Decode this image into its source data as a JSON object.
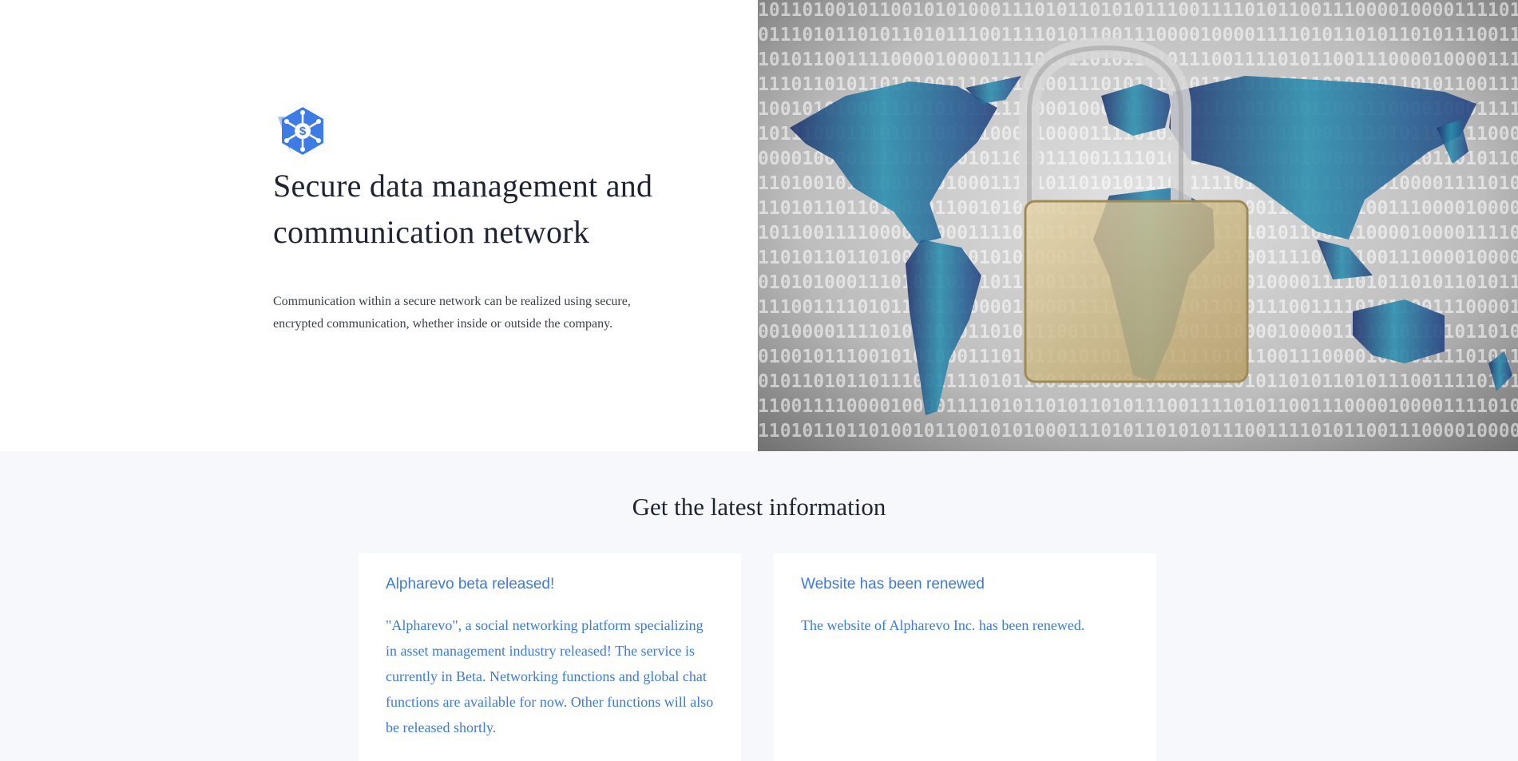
{
  "hero": {
    "title": "Secure data management and communication network",
    "description": "Communication within a secure network can be realized using secure, encrypted communication, whether inside or outside the company.",
    "logo_icon": "hexagon-dollar-network-icon",
    "image_alt": "padlock-world-map-binary-image",
    "binary_rows": [
      "1011010010110010101000111010110101011100111101011001110000100001111010",
      "0111010110101101011100111101011001110000100001111010110101101011100111",
      "1010110011110000100001111010110101101011100111101011001110000100001111",
      "1110110101101010011101010100111010111010110101101110100101101011001110",
      "1001010100011101010111110000100001111010110101101011001110000100011110",
      "1011100011101011001110000100001111010110101101011100111101011001110000",
      "0000100001111010110101101011100111101011001110000100001111010110101101",
      "1101001011100101010001110101101010111001111010110011100001000011110101",
      "1101011011010010110010101000111010110101011100111101011001110000100001",
      "1011001111000010000111101011010110101110011110101100111000010000111101",
      "1101011011010010110010101000111010110101011100111101011001110000100001",
      "0101010001110101101010111001111010110011100001000011110101101011010111",
      "1110011110101100111000010000111101011010110101110011110101100111000010",
      "0010000111101011010110101110011110101100111000010000111101011010110101",
      "0100101110010101000111010110101011100111101011001110000100001111010110",
      "0101101011011100111101011001110000100001111010110101101011100111101011",
      "1100111100001000011110101101011010111001111010110011100001000011110101",
      "1101011011010010110010101000111010110101011100111101011001110000100001"
    ]
  },
  "news": {
    "heading": "Get the latest information",
    "cards": [
      {
        "title": "Alpharevo beta released!",
        "body": "\"Alpharevo\", a social networking platform specializing in asset management industry released! The service is currently in Beta. Networking functions and global chat functions are available for now. Other functions will also be released shortly."
      },
      {
        "title": "Website has been renewed",
        "body": "The website of Alpharevo Inc. has been renewed."
      }
    ]
  },
  "colors": {
    "accent": "#3c7ae0",
    "title": "#1f2433",
    "section_bg": "#f7f8fb",
    "map_dark": "#1e2f6b",
    "map_teal": "#2a8fb0",
    "lock_gold": "#c8b27a"
  }
}
